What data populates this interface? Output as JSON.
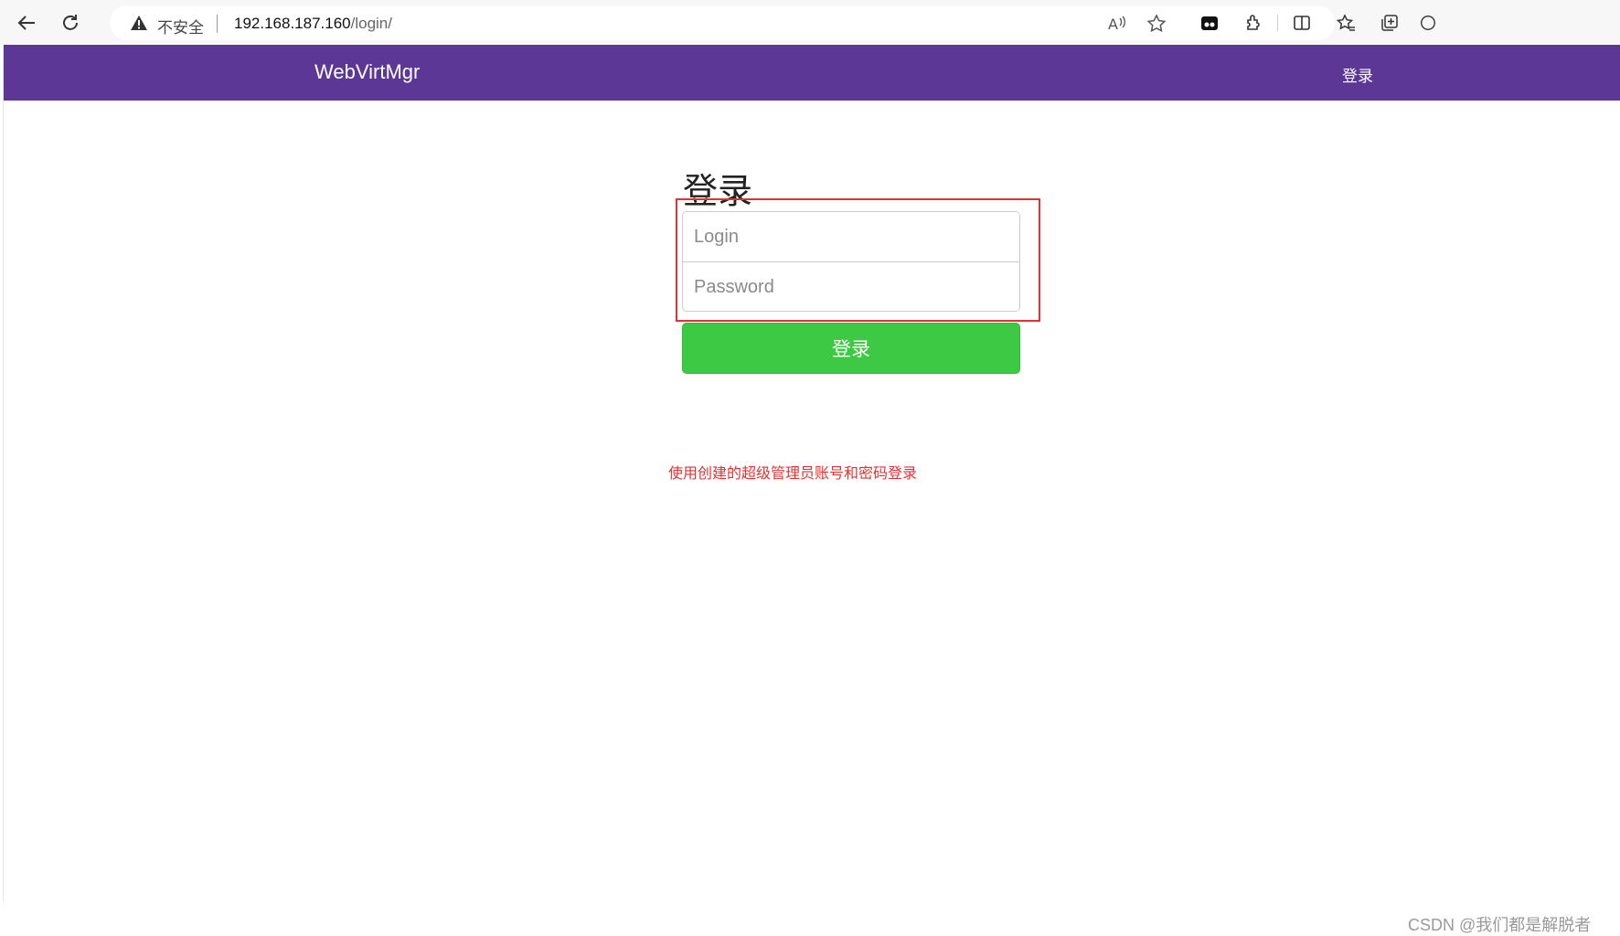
{
  "browser": {
    "security_label": "不安全",
    "url_host": "192.168.187.160",
    "url_path": "/login/",
    "icons": [
      "back-icon",
      "refresh-icon",
      "warning-icon",
      "read-aloud-icon",
      "favorite-icon",
      "extension-app-icon",
      "extensions-icon",
      "split-screen-icon",
      "favorites-icon",
      "collections-icon",
      "profile-icon"
    ]
  },
  "navbar": {
    "brand": "WebVirtMgr",
    "login_link": "登录",
    "color": "#5c3796"
  },
  "form": {
    "title": "登录",
    "login_placeholder": "Login",
    "password_placeholder": "Password",
    "submit_label": "登录",
    "submit_color": "#3ec944"
  },
  "annotation": {
    "hint": "使用创建的超级管理员账号和密码登录",
    "color": "#e23232"
  },
  "watermark": "CSDN @我们都是解脱者"
}
